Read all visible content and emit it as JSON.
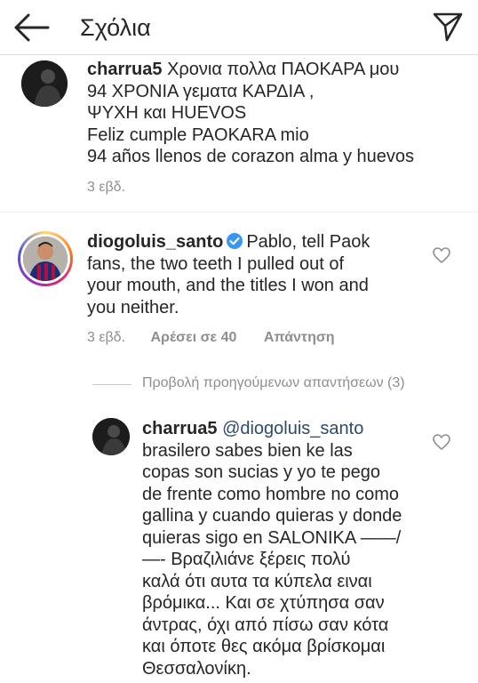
{
  "header": {
    "title": "Σχόλια",
    "back_icon": "arrow-left-icon",
    "send_icon": "paper-plane-icon"
  },
  "comments": [
    {
      "username": "charrua5",
      "lines": [
        "Χρονια πολλα ΠΑΟΚΑΡΑ μου",
        "94 ΧΡΟΝΙΑ γεματα ΚΑΡΔΙΑ ,",
        "ΨΥΧΗ και HUEVOS",
        "Feliz cumple PAOKARA mio",
        "94 años llenos de corazon alma y huevos"
      ],
      "time": "3 εβδ."
    },
    {
      "username": "diogoluis_santo",
      "verified": true,
      "lines": [
        "Pablo, tell Paok",
        "fans, the two teeth I pulled out of",
        "your mouth, and the titles I won and",
        "you neither."
      ],
      "time": "3 εβδ.",
      "likes": "Αρέσει σε 40",
      "reply": "Απάντηση"
    }
  ],
  "view_replies": "Προβολή προηγούμενων απαντήσεων (3)",
  "reply_comment": {
    "username": "charrua5",
    "mention": "@diogoluis_santo",
    "lines": [
      "brasilero sabes bien ke las",
      "copas son sucias  y yo te pego",
      "de frente como hombre no como",
      "gallina y cuando quieras y donde",
      "quieras sigo en SALONIKA ——/",
      "—- Βραζιλιάνε ξέρεις πολύ",
      "καλά ότι αυτα τα κύπελα ειναι",
      "βρόμικα... Και σε χτύπησα σαν",
      "άντρας, όχι από πίσω σαν  κότα",
      "και όποτε θες ακόμα βρίσκομαι",
      "Θεσσαλονίκη."
    ]
  },
  "colors": {
    "text": "#262626",
    "secondary": "#8e8e8e",
    "mention": "#2b4a6f",
    "verified": "#3897f0"
  }
}
